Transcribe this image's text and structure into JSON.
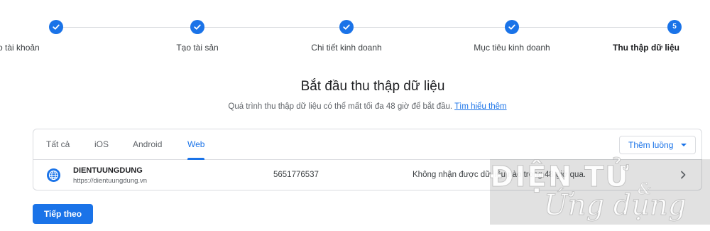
{
  "stepper": {
    "steps": [
      {
        "label": "Tạo tài khoản",
        "state": "done"
      },
      {
        "label": "Tạo tài sản",
        "state": "done"
      },
      {
        "label": "Chi tiết kinh doanh",
        "state": "done"
      },
      {
        "label": "Mục tiêu kinh doanh",
        "state": "done"
      },
      {
        "label": "Thu thập dữ liệu",
        "state": "current",
        "number": "5"
      }
    ],
    "check_icon": "check-icon"
  },
  "heading": {
    "title": "Bắt đầu thu thập dữ liệu",
    "subtitle": "Quá trình thu thập dữ liệu có thể mất tối đa 48 giờ để bắt đầu.",
    "learn_more": "Tìm hiểu thêm"
  },
  "streams": {
    "tabs": [
      "Tất cả",
      "iOS",
      "Android",
      "Web"
    ],
    "active_tab": "Web",
    "add_stream_label": "Thêm luồng",
    "rows": [
      {
        "icon": "globe-icon",
        "name": "DIENTUUNGDUNG",
        "url": "https://dientuungdung.vn",
        "id": "5651776537",
        "status": "Không nhận được dữ liệu nào trong 48 giờ qua."
      }
    ]
  },
  "actions": {
    "next_label": "Tiếp theo"
  },
  "watermark": {
    "line1": "ĐIỆN TỬ",
    "amp": "&",
    "line2": "Ứng dụng"
  },
  "colors": {
    "accent": "#1a73e8",
    "text_primary": "#202124",
    "text_secondary": "#5f6368",
    "divider": "#dadce0"
  }
}
